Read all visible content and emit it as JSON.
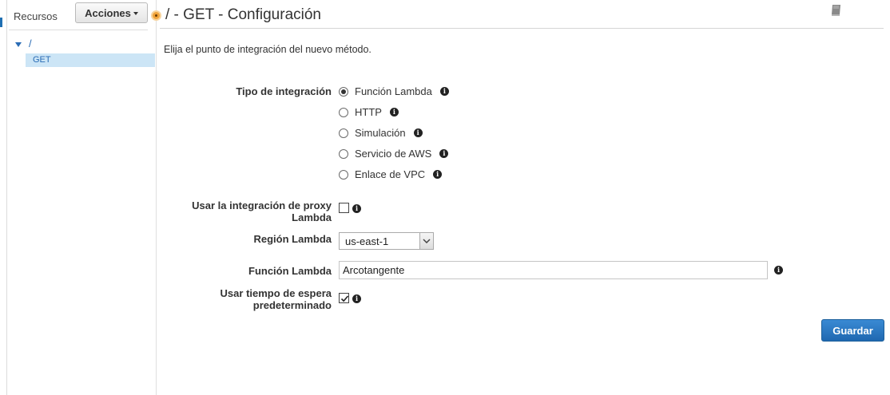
{
  "sidebar": {
    "title": "Recursos",
    "actions_label": "Acciones",
    "tree": {
      "root": "/",
      "method": "GET"
    }
  },
  "header": {
    "title": "/ - GET - Configuración"
  },
  "form": {
    "instruction": "Elija el punto de integración del nuevo método.",
    "integration_type": {
      "label": "Tipo de integración",
      "options": [
        "Función Lambda",
        "HTTP",
        "Simulación",
        "Servicio de AWS",
        "Enlace de VPC"
      ],
      "selected": "Función Lambda"
    },
    "proxy": {
      "label_line1": "Usar la integración de proxy",
      "label_line2": "Lambda",
      "checked": false
    },
    "region": {
      "label": "Región Lambda",
      "value": "us-east-1"
    },
    "lambda_function": {
      "label": "Función Lambda",
      "value": "Arcotangente"
    },
    "default_timeout": {
      "label_line1": "Usar tiempo de espera",
      "label_line2": "predeterminado",
      "checked": true
    },
    "save_label": "Guardar"
  },
  "icons": {
    "info": "info-icon",
    "book": "book-icon",
    "resize": "resize-handle-icon"
  },
  "colors": {
    "link": "#2a6cb5",
    "primary_button": "#1f6fb2",
    "selected_row": "#cce5f6",
    "handle": "#f0a33b"
  }
}
